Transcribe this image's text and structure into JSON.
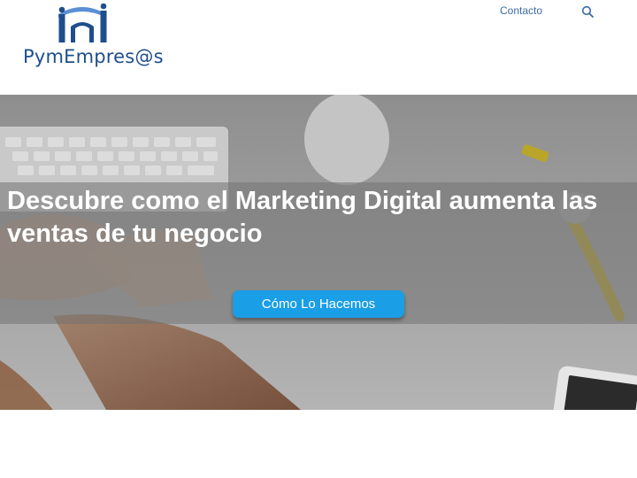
{
  "brand": {
    "name": "PymEmpres@s",
    "logo_icon": "people-arch-logo-icon",
    "color": "#1f4e8c"
  },
  "nav": {
    "contact_label": "Contacto",
    "search_icon": "search-icon",
    "link_color": "#3a6aa5"
  },
  "hero": {
    "title": "Descubre como el Marketing Digital aumenta las ventas de tu negocio",
    "cta_label": "Cómo Lo Hacemos",
    "cta_color": "#1a9ee6",
    "background": "photo-desk-keyboard-hands"
  }
}
